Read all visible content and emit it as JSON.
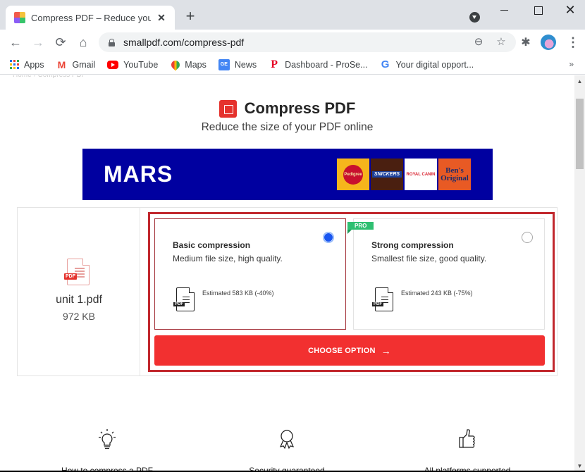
{
  "browser": {
    "tab_title": "Compress PDF – Reduce your PDF",
    "tab_close": "✕",
    "new_tab": "+",
    "url": "smallpdf.com/compress-pdf",
    "window": {
      "minimize": "",
      "maximize": "",
      "close": "✕"
    },
    "nav": {
      "back": "←",
      "forward": "→",
      "reload": "⟳",
      "home": "⌂"
    },
    "omnibox_icons": {
      "zoom": "⊖",
      "bookmark": "☆"
    },
    "extensions": "✱",
    "menu": "⋮",
    "bookmarks": [
      {
        "label": "Apps",
        "icon": "apps-icon"
      },
      {
        "label": "Gmail",
        "icon": "gmail-icon",
        "glyph": "M"
      },
      {
        "label": "YouTube",
        "icon": "youtube-icon"
      },
      {
        "label": "Maps",
        "icon": "maps-icon"
      },
      {
        "label": "News",
        "icon": "news-icon",
        "glyph": "GE"
      },
      {
        "label": "Dashboard - ProSe...",
        "icon": "pinterest-icon",
        "glyph": "P"
      },
      {
        "label": "Your digital opport...",
        "icon": "google-icon",
        "glyph": "G"
      }
    ],
    "bookmarks_more": "»"
  },
  "page": {
    "breadcrumb": "Home › Compress PDF",
    "title": "Compress PDF",
    "subtitle": "Reduce the size of your PDF online",
    "ad": {
      "brand": "MARS",
      "logos": [
        "Pedigree",
        "SNICKERS",
        "ROYAL CANIN",
        "Ben's Original"
      ]
    },
    "file": {
      "name": "unit 1.pdf",
      "size": "972 KB",
      "tag": "PDF"
    },
    "options": [
      {
        "name": "Basic compression",
        "description": "Medium file size, high quality.",
        "estimate": "Estimated 583 KB (-40%)",
        "selected": true,
        "pro": false
      },
      {
        "name": "Strong compression",
        "description": "Smallest file size, good quality.",
        "estimate": "Estimated 243 KB (-75%)",
        "selected": false,
        "pro": true,
        "badge": "PRO"
      }
    ],
    "file_tag": "PDF",
    "choose_button": "CHOOSE OPTION",
    "choose_arrow": "→",
    "features": [
      {
        "label": "How to compress a PDF",
        "icon": "lightbulb-icon"
      },
      {
        "label": "Security guaranteed",
        "icon": "award-ribbon-icon"
      },
      {
        "label": "All platforms supported",
        "icon": "thumbs-up-icon"
      }
    ]
  },
  "colors": {
    "brand_red": "#e5322d",
    "button_red": "#f23030",
    "frame_red": "#c1272d",
    "pro_green": "#2fbf71",
    "radio_blue": "#1a56f0",
    "ad_blue": "#0000a0"
  },
  "scrollbar": {
    "up": "▲",
    "down": "▼"
  }
}
